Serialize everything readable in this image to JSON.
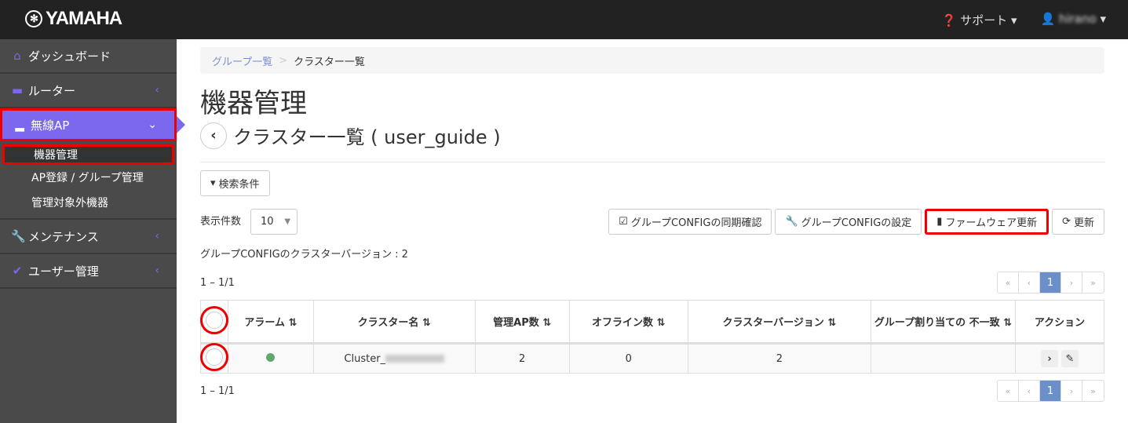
{
  "header": {
    "brand": "YAMAHA",
    "support": "サポート",
    "user": "hirano"
  },
  "sidebar": {
    "items": [
      {
        "label": "ダッシュボード",
        "icon": "home-icon"
      },
      {
        "label": "ルーター",
        "icon": "router-icon"
      },
      {
        "label": "無線AP",
        "icon": "access-point-icon"
      },
      {
        "label": "メンテナンス",
        "icon": "wrench-icon"
      },
      {
        "label": "ユーザー管理",
        "icon": "check-icon"
      }
    ],
    "sub": [
      "機器管理",
      "AP登録 / グループ管理",
      "管理対象外機器"
    ]
  },
  "breadcrumb": [
    "グループ一覧",
    "クラスター一覧"
  ],
  "page": {
    "title": "機器管理",
    "subtitle": "クラスター一覧 ( user_guide )",
    "search": "検索条件",
    "per_page_label": "表示件数",
    "per_page": "10",
    "buttons": [
      "グループCONFIGの同期確認",
      "グループCONFIGの設定",
      "ファームウェア更新",
      "更新"
    ],
    "version_text": "グループCONFIGのクラスターバージョン : 2",
    "range": "1 – 1/1"
  },
  "pagination": [
    "«",
    "‹",
    "1",
    "›",
    "»"
  ],
  "table": {
    "headers": [
      "アラーム ⇅",
      "クラスター名 ⇅",
      "管理AP数 ⇅",
      "オフライン数 ⇅",
      "クラスターバージョン ⇅",
      "グループ割り当ての 不一致 ⇅",
      "アクション"
    ],
    "rows": [
      {
        "alarm": "green",
        "name": "Cluster_",
        "aps": "2",
        "offline": "0",
        "version": "2",
        "mismatch": ""
      }
    ]
  },
  "colors": {
    "accent": "#7b68ee",
    "highlight": "#e00000",
    "alarm_ok": "#5fa86f"
  }
}
